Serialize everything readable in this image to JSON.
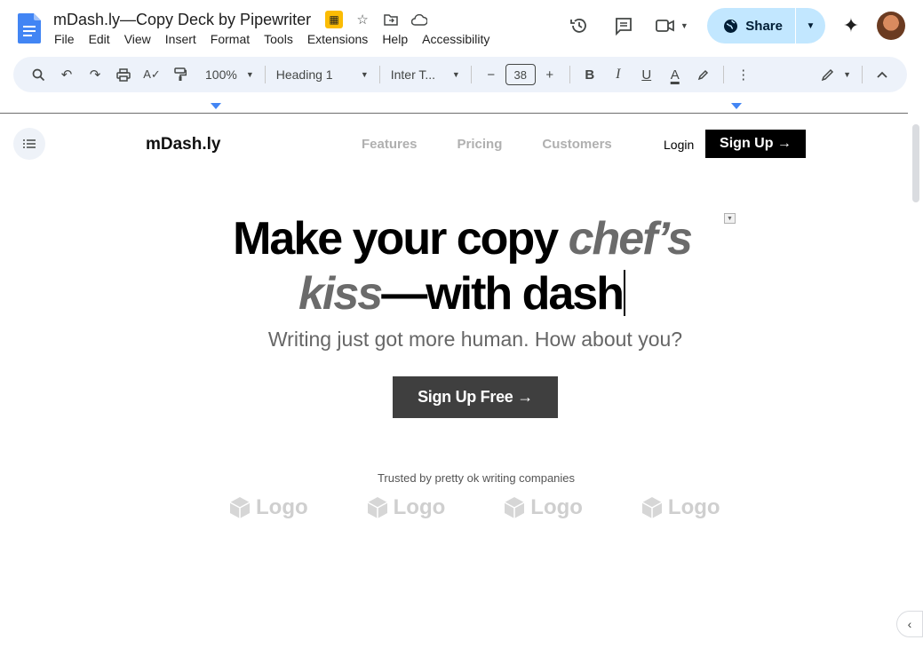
{
  "app": {
    "doc_title": "mDash.ly—Copy Deck by Pipewriter",
    "menu": [
      "File",
      "Edit",
      "View",
      "Insert",
      "Format",
      "Tools",
      "Extensions",
      "Help",
      "Accessibility"
    ],
    "share_label": "Share"
  },
  "toolbar": {
    "zoom": "100%",
    "style": "Heading 1",
    "font": "Inter T...",
    "font_size": "38",
    "bold": "B",
    "italic": "I",
    "underline": "U",
    "text_color": "A",
    "minus": "−",
    "plus": "+"
  },
  "page": {
    "brand": "mDash.ly",
    "nav": [
      "Features",
      "Pricing",
      "Customers"
    ],
    "login": "Login",
    "signup": "Sign Up →",
    "headline_part1": "Make your copy ",
    "headline_em1": "chef’s",
    "headline_em2": "kiss",
    "headline_part2": "—with dash",
    "subhead": "Writing just got more human. How about you?",
    "cta": "Sign Up Free →",
    "trusted": "Trusted by pretty ok writing companies",
    "logos": [
      "Logo",
      "Logo",
      "Logo",
      "Logo"
    ]
  },
  "colors": {
    "share_bg": "#c2e7ff",
    "toolbar_bg": "#edf2fa",
    "accent_blue": "#4285f4",
    "title_badge": "#fbbc04"
  }
}
